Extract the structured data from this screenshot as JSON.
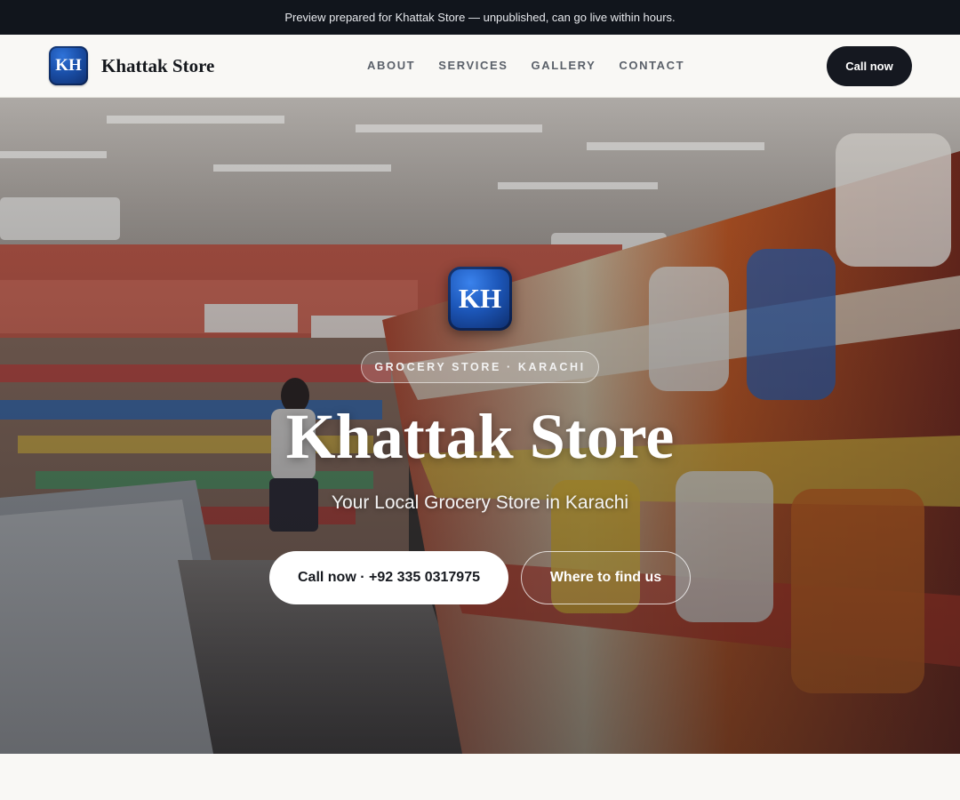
{
  "announcement": {
    "text": "Preview prepared for Khattak Store — unpublished, can go live within hours."
  },
  "header": {
    "logo_initials": "KH",
    "brand_name": "Khattak Store",
    "nav": [
      {
        "label": "ABOUT"
      },
      {
        "label": "SERVICES"
      },
      {
        "label": "GALLERY"
      },
      {
        "label": "CONTACT"
      }
    ],
    "cta_label": "Call now"
  },
  "hero": {
    "badge_initials": "KH",
    "category_chip": "GROCERY STORE · KARACHI",
    "title": "Khattak Store",
    "subtitle": "Your Local Grocery Store in Karachi",
    "primary_button": "Call now · +92 335 0317975",
    "secondary_button": "Where to find us",
    "background_image": "grocery-store-aisle-photo"
  },
  "colors": {
    "topbar_bg": "#11151c",
    "page_bg": "#f9f8f5",
    "cta_bg": "#151820",
    "logo_blue": "#1a4fa8"
  }
}
